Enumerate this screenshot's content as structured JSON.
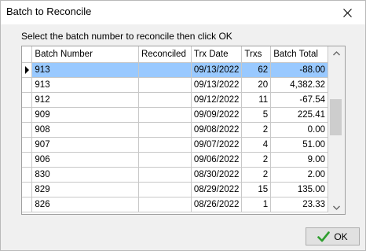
{
  "window": {
    "title": "Batch to Reconcile"
  },
  "instruction": "Select the batch number to reconcile then click OK",
  "grid": {
    "columns": [
      "Batch Number",
      "Reconciled",
      "Trx Date",
      "Trxs",
      "Batch Total"
    ],
    "rows": [
      {
        "batch": "913",
        "reconciled": "",
        "date": "09/13/2022",
        "trxs": "62",
        "total": "-88.00",
        "selected": true
      },
      {
        "batch": "913",
        "reconciled": "",
        "date": "09/13/2022",
        "trxs": "20",
        "total": "4,382.32"
      },
      {
        "batch": "912",
        "reconciled": "",
        "date": "09/12/2022",
        "trxs": "11",
        "total": "-67.54"
      },
      {
        "batch": "909",
        "reconciled": "",
        "date": "09/09/2022",
        "trxs": "5",
        "total": "225.41"
      },
      {
        "batch": "908",
        "reconciled": "",
        "date": "09/08/2022",
        "trxs": "2",
        "total": "0.00"
      },
      {
        "batch": "907",
        "reconciled": "",
        "date": "09/07/2022",
        "trxs": "4",
        "total": "51.00"
      },
      {
        "batch": "906",
        "reconciled": "",
        "date": "09/06/2022",
        "trxs": "2",
        "total": "9.00"
      },
      {
        "batch": "830",
        "reconciled": "",
        "date": "08/30/2022",
        "trxs": "2",
        "total": "2.00"
      },
      {
        "batch": "829",
        "reconciled": "",
        "date": "08/29/2022",
        "trxs": "15",
        "total": "135.00"
      },
      {
        "batch": "826",
        "reconciled": "",
        "date": "08/26/2022",
        "trxs": "1",
        "total": "23.33"
      }
    ]
  },
  "buttons": {
    "ok_label": "OK",
    "ok_icon": "checkmark-icon",
    "close_icon": "close-icon"
  },
  "colors": {
    "selection": "#99c9ff",
    "ok_check": "#2e9e2e"
  }
}
